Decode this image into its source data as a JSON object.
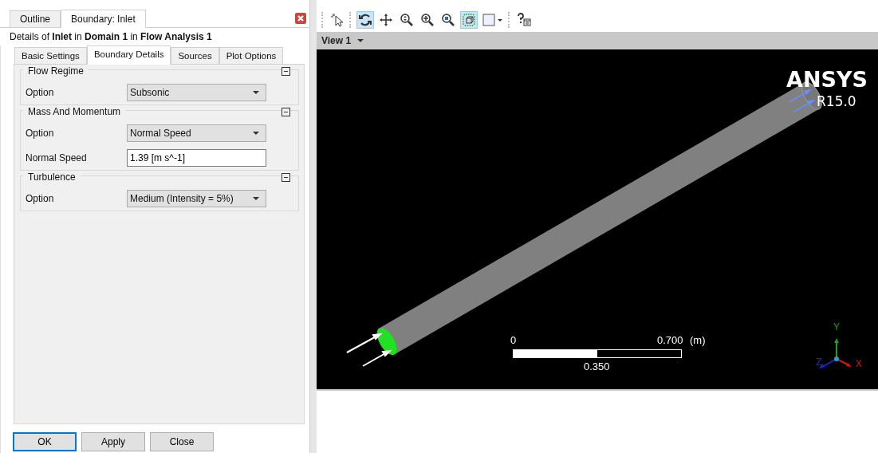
{
  "panel_tabs": [
    {
      "label": "Outline",
      "selected": false
    },
    {
      "label": "Boundary: Inlet",
      "selected": true
    }
  ],
  "details": "Details of **Inlet** in **Domain 1** in **Flow Analysis 1**",
  "detail_tabs": [
    {
      "label": "Basic Settings",
      "selected": false
    },
    {
      "label": "Boundary Details",
      "selected": true
    },
    {
      "label": "Sources",
      "selected": false
    },
    {
      "label": "Plot Options",
      "selected": false
    }
  ],
  "groups": [
    {
      "title": "Flow Regime",
      "expanded": true,
      "rows": [
        {
          "label": "Option",
          "kind": "dropdown",
          "value": "Subsonic"
        }
      ]
    },
    {
      "title": "Mass And Momentum",
      "expanded": true,
      "rows": [
        {
          "label": "Option",
          "kind": "dropdown",
          "value": "Normal Speed"
        },
        {
          "label": "Normal Speed",
          "kind": "input",
          "value": "1.39 [m s^-1]"
        }
      ]
    },
    {
      "title": "Turbulence",
      "expanded": true,
      "rows": [
        {
          "label": "Option",
          "kind": "dropdown",
          "value": "Medium (Intensity = 5%)"
        }
      ]
    }
  ],
  "buttons": [
    {
      "label": "OK",
      "focused": true
    },
    {
      "label": "Apply",
      "focused": false
    },
    {
      "label": "Close",
      "focused": false
    }
  ],
  "toolbar": [
    {
      "kind": "pointer",
      "selected": false
    },
    {
      "kind": "rotate",
      "selected": true
    },
    {
      "kind": "pan",
      "selected": false
    },
    {
      "kind": "zoom-box",
      "selected": false
    },
    {
      "kind": "zoom-in",
      "selected": false
    },
    {
      "kind": "zoom-fit",
      "selected": false
    },
    {
      "kind": "highlight",
      "selected": true
    },
    {
      "kind": "rectangle",
      "selected": false
    },
    {
      "kind": "help",
      "selected": false
    }
  ],
  "view": {
    "title": "View 1",
    "logo": "ANSYS",
    "version": "R15.0",
    "scale": {
      "start": "0",
      "end": "0.700",
      "unit": "(m)",
      "mid": "0.350"
    },
    "axes": {
      "x": "X",
      "y": "Y",
      "z": "Z"
    }
  }
}
